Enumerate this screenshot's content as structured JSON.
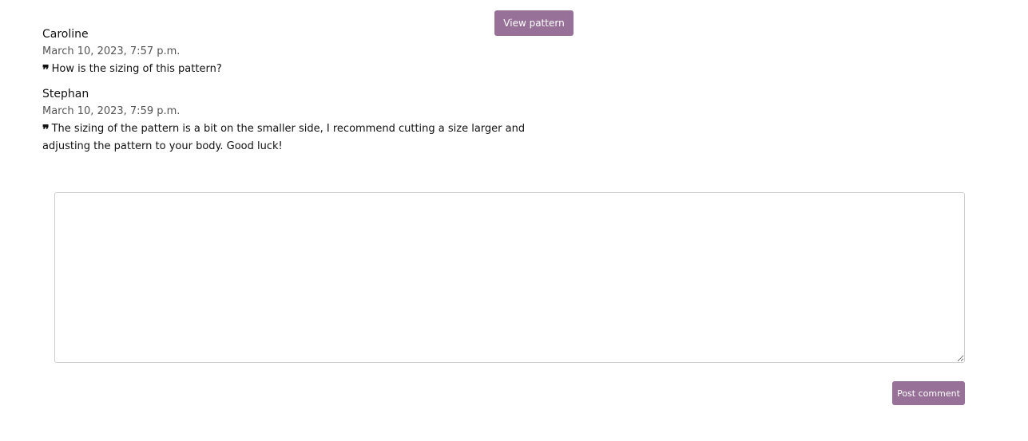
{
  "header": {
    "view_pattern_label": "View pattern"
  },
  "comments": [
    {
      "author": "Caroline",
      "date": "March 10, 2023, 7:57 p.m.",
      "quote_icon": "❞",
      "text": "How is the sizing of this pattern?"
    },
    {
      "author": "Stephan",
      "date": "March 10, 2023, 7:59 p.m.",
      "quote_icon": "❞",
      "text": "The sizing of the pattern is a bit on the smaller side, I recommend cutting a size larger and adjusting the pattern to your body. Good luck!"
    }
  ],
  "form": {
    "textarea_value": "",
    "post_label": "Post comment"
  },
  "colors": {
    "accent": "#977198"
  }
}
